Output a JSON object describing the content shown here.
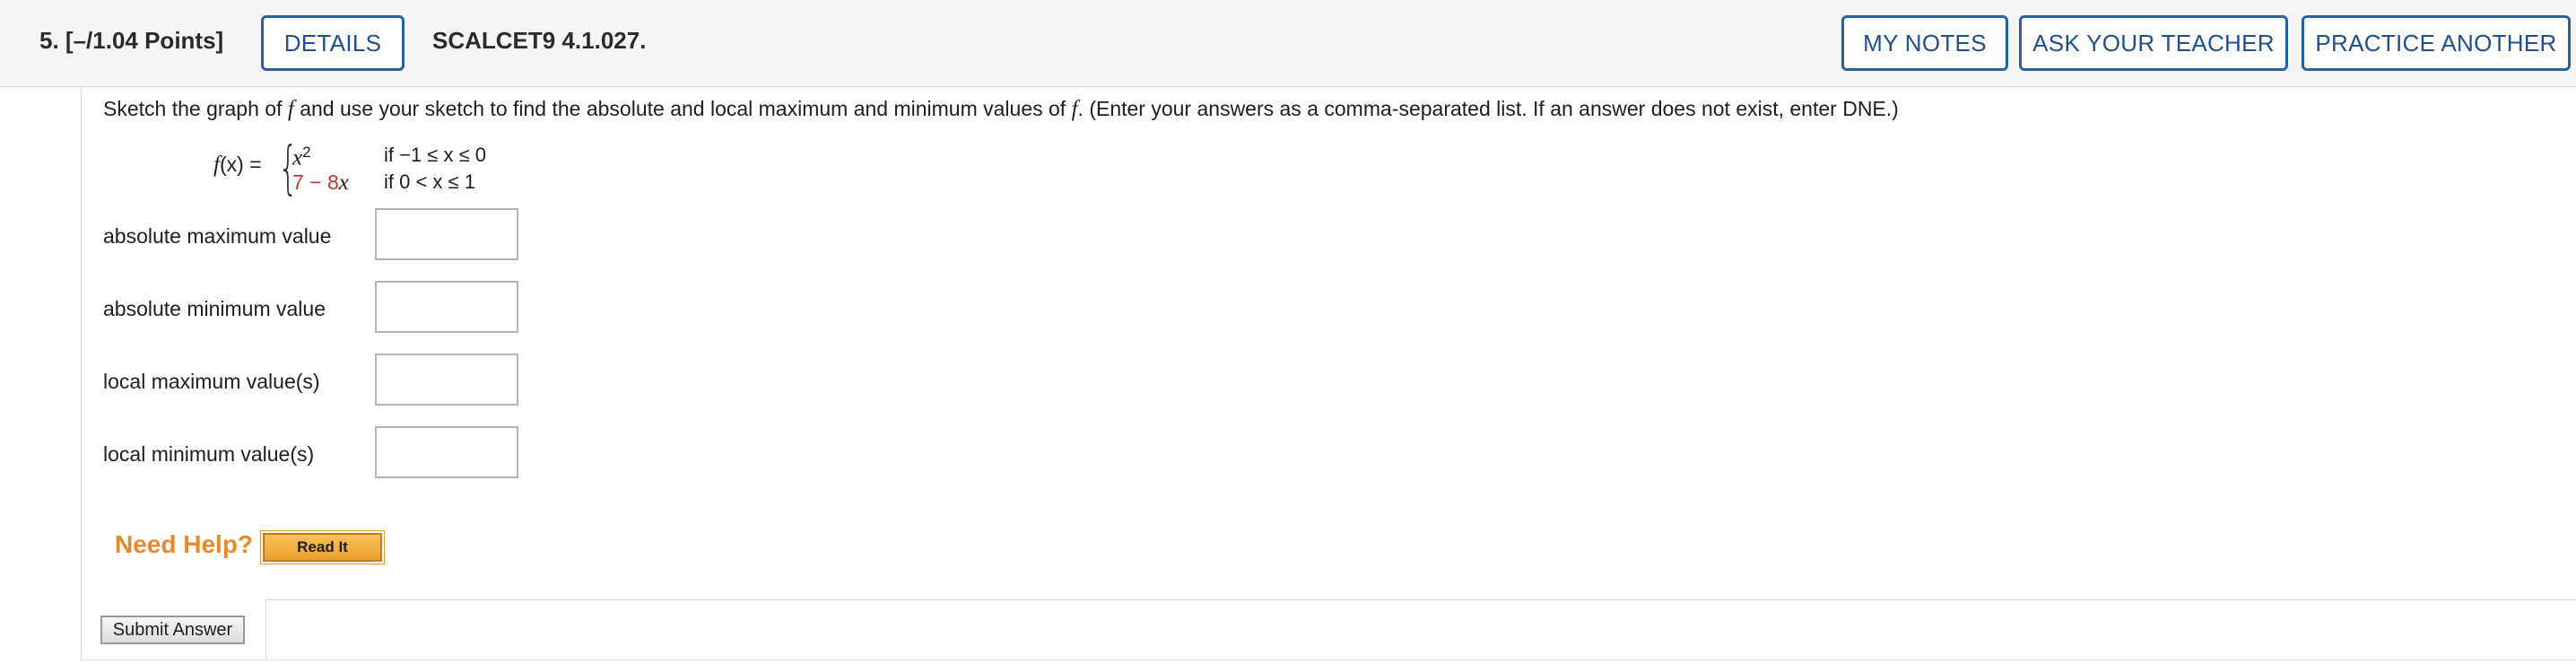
{
  "header": {
    "question_number": "5.",
    "points": "[–/1.04 Points]",
    "details_label": "DETAILS",
    "problem_code": "SCALCET9 4.1.027.",
    "my_notes_label": "MY NOTES",
    "ask_teacher_label": "ASK YOUR TEACHER",
    "practice_another_label": "PRACTICE ANOTHER"
  },
  "question": {
    "prompt_a": "Sketch the graph of ",
    "prompt_f1": "f",
    "prompt_b": " and use your sketch to find the absolute and local maximum and minimum values of ",
    "prompt_f2": "f",
    "prompt_c": ". (Enter your answers as a comma-separated list. If an answer does not exist, enter DNE.)",
    "function_lhs_f": "f",
    "function_lhs_rest": "(x) =",
    "case1_expr_var": "x",
    "case1_expr_exp": "2",
    "case1_condition": "if −1 ≤ x ≤ 0",
    "case2_expr_const": "7 − 8",
    "case2_expr_var": "x",
    "case2_condition": "if 0 < x ≤ 1"
  },
  "answers": [
    {
      "label": "absolute maximum value",
      "value": ""
    },
    {
      "label": "absolute minimum value",
      "value": ""
    },
    {
      "label": "local maximum value(s)",
      "value": ""
    },
    {
      "label": "local minimum value(s)",
      "value": ""
    }
  ],
  "help": {
    "need_help_label": "Need Help?",
    "read_it_label": "Read It"
  },
  "submit_label": "Submit Answer",
  "colors": {
    "button_border": "#2a5fa0",
    "need_help": "#e8892c",
    "highlight_red": "#c0392b"
  }
}
